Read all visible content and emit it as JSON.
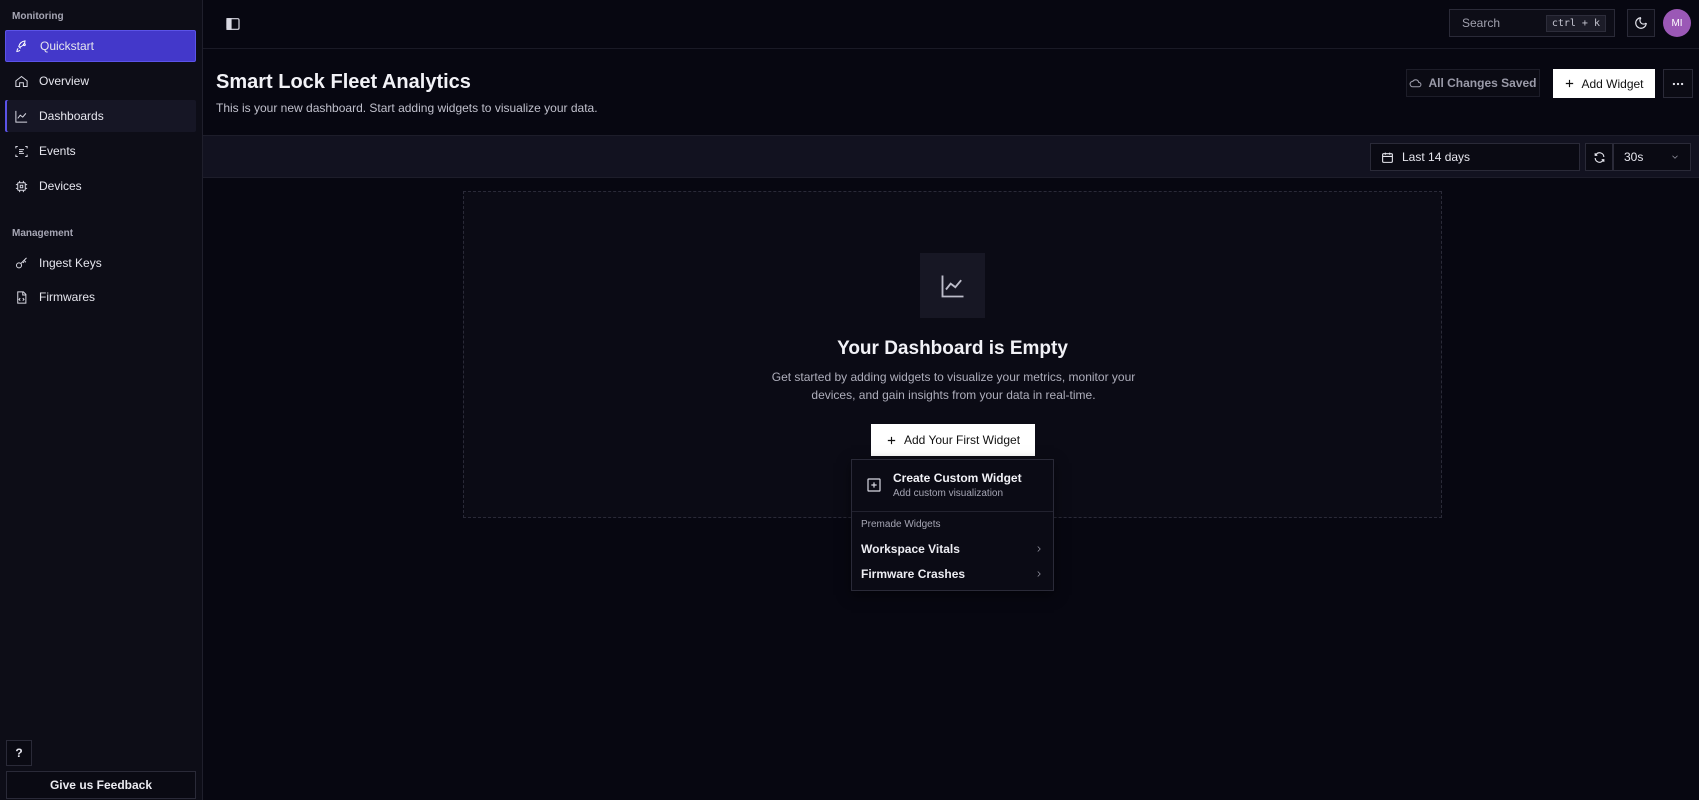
{
  "sidebar": {
    "sections": [
      {
        "label": "Monitoring"
      },
      {
        "label": "Management"
      }
    ],
    "items": [
      {
        "label": "Quickstart",
        "icon": "rocket-icon"
      },
      {
        "label": "Overview",
        "icon": "home-icon"
      },
      {
        "label": "Dashboards",
        "icon": "chart-line-icon"
      },
      {
        "label": "Events",
        "icon": "list-scan-icon"
      },
      {
        "label": "Devices",
        "icon": "chip-icon"
      },
      {
        "label": "Ingest Keys",
        "icon": "key-icon"
      },
      {
        "label": "Firmwares",
        "icon": "file-code-icon"
      }
    ],
    "help_label": "?",
    "feedback_label": "Give us Feedback"
  },
  "topbar": {
    "search_placeholder": "Search",
    "search_shortcut": "ctrl + k",
    "avatar_initials": "MI"
  },
  "header": {
    "title": "Smart Lock Fleet Analytics",
    "subtitle": "This is your new dashboard. Start adding widgets to visualize your data.",
    "saved_label": "All Changes Saved",
    "add_widget_label": "Add Widget"
  },
  "filters": {
    "date_range": "Last 14 days",
    "refresh_interval": "30s"
  },
  "empty_state": {
    "title": "Your Dashboard is Empty",
    "description": "Get started by adding widgets to visualize your metrics, monitor your devices, and gain insights from your data in real-time.",
    "button_label": "Add Your First Widget"
  },
  "dropdown": {
    "custom_title": "Create Custom Widget",
    "custom_subtitle": "Add custom visualization",
    "premade_section": "Premade Widgets",
    "premade_items": [
      {
        "label": "Workspace Vitals"
      },
      {
        "label": "Firmware Crashes"
      }
    ]
  },
  "colors": {
    "accent": "#4338ca",
    "background": "#070711",
    "avatar": "#9b58b6"
  }
}
